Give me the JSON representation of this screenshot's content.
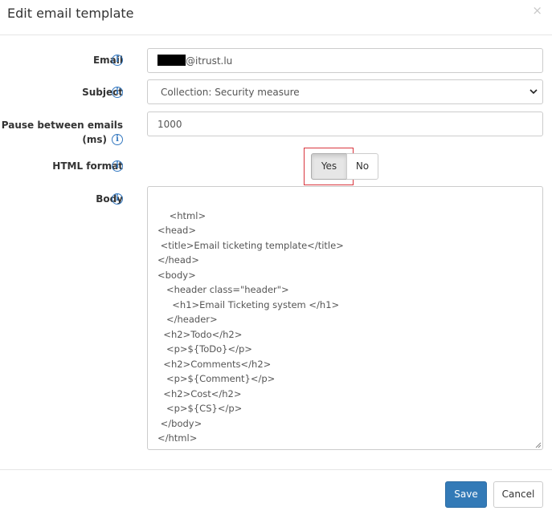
{
  "dialog": {
    "title": "Edit email template",
    "close_glyph": "×"
  },
  "form": {
    "email": {
      "label": "Email",
      "value_suffix": "@itrust.lu"
    },
    "subject": {
      "label": "Subject",
      "value": "Collection: Security measure"
    },
    "pause": {
      "label_line1": "Pause between emails",
      "label_line2": "(ms)",
      "value": "1000"
    },
    "html_format": {
      "label": "HTML format",
      "yes_label": "Yes",
      "no_label": "No",
      "selected": "Yes"
    },
    "body": {
      "label": "Body",
      "value": "<html>\n<head>\n <title>Email ticketing template</title>\n</head>\n<body>\n   <header class=\"header\">\n     <h1>Email Ticketing system </h1>\n   </header>\n  <h2>Todo</h2>\n   <p>${ToDo}</p>\n  <h2>Comments</h2>\n   <p>${Comment}</p>\n  <h2>Cost</h2>\n   <p>${CS}</p>\n </body>\n</html>"
    }
  },
  "footer": {
    "save_label": "Save",
    "cancel_label": "Cancel"
  },
  "icons": {
    "info": "info-icon",
    "close": "close-icon",
    "caret": "chevron-down-icon"
  },
  "colors": {
    "primary": "#337ab7",
    "highlight_border": "#d9363e",
    "info": "#3478c0"
  }
}
